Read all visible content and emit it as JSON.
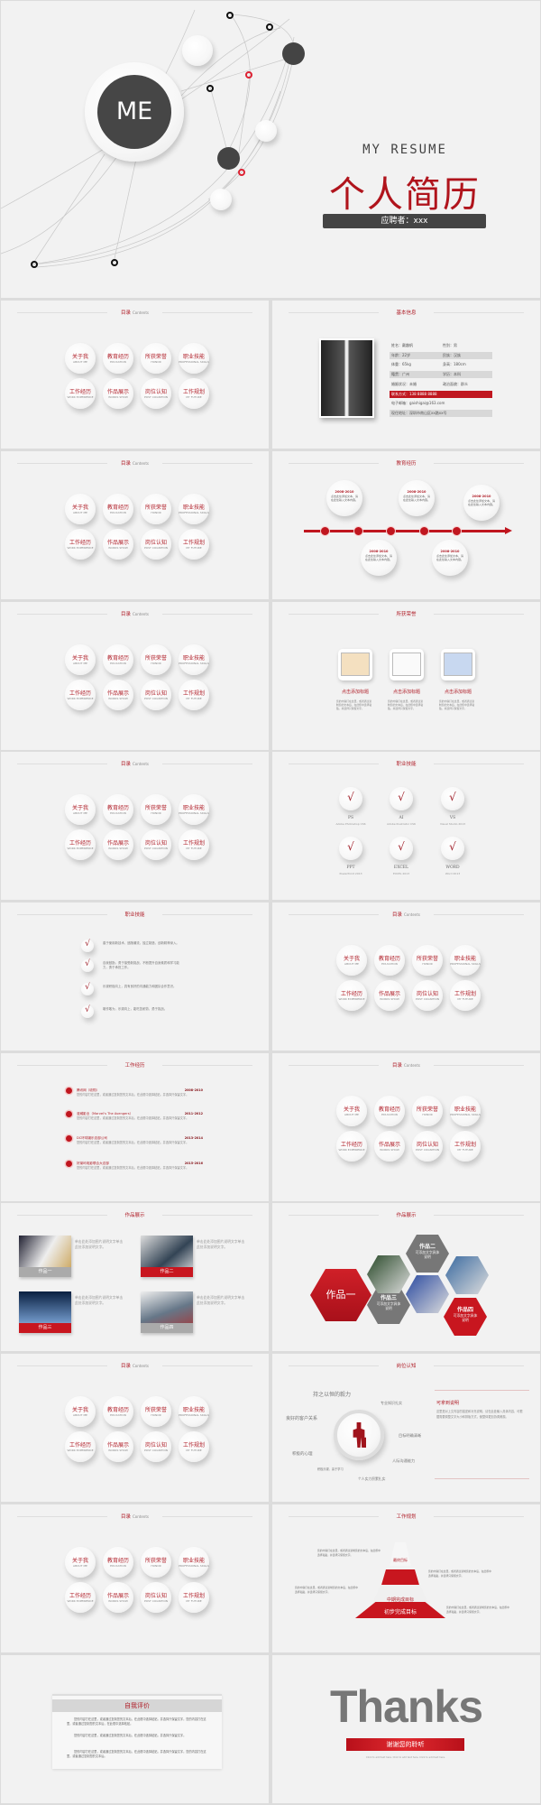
{
  "cover": {
    "me": "ME",
    "subtitle": "MY RESUME",
    "title": "个人简历",
    "applicant": "应聘者：xxx"
  },
  "contents": {
    "title": "目录",
    "title_en": "Contents",
    "items": [
      {
        "t": "关于我",
        "s": "ABOUT ME"
      },
      {
        "t": "教育经历",
        "s": "EDUCATION"
      },
      {
        "t": "所获荣誉",
        "s": "HONOR"
      },
      {
        "t": "职业技能",
        "s": "PROFESSIONAL SKILLS"
      },
      {
        "t": "工作经历",
        "s": "WORK EXPERIENCE"
      },
      {
        "t": "作品展示",
        "s": "WORKS SHOW"
      },
      {
        "t": "岗位认知",
        "s": "POST COGNITION"
      },
      {
        "t": "工作规划",
        "s": "MY FUTURE"
      }
    ]
  },
  "basic": {
    "title": "基本信息",
    "rows": [
      [
        "姓名：戴趣帆",
        "性别：男"
      ],
      [
        "年龄：22岁",
        "民族：汉族"
      ],
      [
        "体重：65kg",
        "身高：180cm"
      ],
      [
        "籍贯：广州",
        "学历：本科"
      ],
      [
        "婚姻状况：未婚",
        "政治面貌：群众"
      ],
      [
        "联系方式：138 8888 8888"
      ],
      [
        "电子邮箱：gaishigai@163.com"
      ],
      [
        "现住地址：深圳市南山区xx路xx号"
      ]
    ]
  },
  "education": {
    "title": "教育经历",
    "items": [
      {
        "date": "2008-2010",
        "text": "点击此处添加文本，请在此处输入文本内容。"
      },
      {
        "date": "2008-2010",
        "text": "点击此处添加文本，请在此处输入文本内容。"
      },
      {
        "date": "2008-2010",
        "text": "点击此处添加文本，请在此处输入文本内容。"
      },
      {
        "date": "2008-2010",
        "text": "点击此处添加文本，请在此处输入文本内容。"
      },
      {
        "date": "2008-2010",
        "text": "点击此处添加文本，请在此处输入文本内容。"
      }
    ]
  },
  "honor": {
    "title": "所获荣誉",
    "items": [
      {
        "t": "点击添加标题",
        "d": "您的内容打在这里，或者通过复制您的文本后，在此框中选择粘贴，并选择只保留文字。"
      },
      {
        "t": "点击添加标题",
        "d": "您的内容打在这里，或者通过复制您的文本后，在此框中选择粘贴，并选择只保留文字。"
      },
      {
        "t": "点击添加标题",
        "d": "您的内容打在这里，或者通过复制您的文本后，在此框中选择粘贴，并选择只保留文字。"
      }
    ]
  },
  "skills": {
    "title": "职业技能",
    "check": "√",
    "items": [
      {
        "t": "PS",
        "s": "Adobe Photoshop CS6"
      },
      {
        "t": "AI",
        "s": "Adobe Illustrator CS6"
      },
      {
        "t": "VS",
        "s": "Visual Studio 2013"
      },
      {
        "t": "PPT",
        "s": "PowerPoint 2013"
      },
      {
        "t": "EXCEL",
        "s": "EXCEL 2013"
      },
      {
        "t": "WORD",
        "s": "Word 2013"
      }
    ]
  },
  "skills2": {
    "title": "职业技能",
    "items": [
      "善于使用新技术，追随潮流，独立制造，创新精神深入。",
      "自我鼓励，勇于接受新挑战，不断提升自身素质和学习能力，勇于承担工作。",
      "乐观积极向上，具有良好的沟通能力和团队合作意识。",
      "敢作敢为，乐观向上，能吃苦耐劳，勇于挑战。"
    ]
  },
  "work": {
    "title": "工作经历",
    "items": [
      {
        "t": "腾讯网（收购）",
        "date": "2008-2010",
        "d": "您的内容打在这里，或者通过复制您的文本后，在此框中选择粘贴，并选择只保留文字。"
      },
      {
        "t": "漫威影业（Marvel's The Avengers）",
        "date": "2011-2012",
        "d": "您的内容打在这里，或者通过复制您的文本后，在此框中选择粘贴，并选择只保留文字。"
      },
      {
        "t": "DC环球娱乐总部公司",
        "date": "2013-2014",
        "d": "您的内容打在这里，或者通过复制您的文本后，在此框中选择粘贴，并选择只保留文字。"
      },
      {
        "t": "好莱坞电影联合大总部",
        "date": "2015-2016",
        "d": "您的内容打在这里，或者通过复制您的文本后，在此框中选择粘贴，并选择只保留文字。"
      }
    ]
  },
  "works": {
    "title": "作品展示",
    "items": [
      {
        "label": "作品一",
        "d": "单击此处添加图片说明文字单击此处添加说明文字。"
      },
      {
        "label": "作品二",
        "d": "单击此处添加图片说明文字单击此处添加说明文字。"
      },
      {
        "label": "作品三",
        "d": "单击此处添加图片说明文字单击此处添加说明文字。"
      },
      {
        "label": "作品四",
        "d": "单击此处添加图片说明文字单击此处添加说明文字。"
      }
    ]
  },
  "hex": {
    "title": "作品展示",
    "main": "作品一",
    "items": [
      {
        "t": "作品二",
        "s": "可添加文字具体说明"
      },
      {
        "t": "作品三",
        "s": "可添加文字具体说明"
      },
      {
        "t": "作品四",
        "s": "可添加文字具体说明"
      }
    ]
  },
  "post": {
    "title": "岗位认知",
    "labels": [
      "持之以恒的毅力",
      "良好的客户关系",
      "专业知识扎实",
      "目标明确清晰",
      "积极的心理",
      "积极乐观、善于学习",
      "人际沟通能力",
      "个人实力积累扎实"
    ],
    "panel_title": "可拿到说明",
    "panel_text": "这里是对上文内容的描述和补充说明，请在此处输入具体内容，可根据需要调整文字大小和排版方式，使整体更加协调美观。"
  },
  "plan": {
    "title": "工作规划",
    "levels": [
      "最终目标",
      "自我超越",
      "中期完成目标",
      "初步完成目标"
    ],
    "desc": "您的内容打在这里，或者通过复制您的文本后，在此框中选择粘贴，并选择只保留文字。"
  },
  "self": {
    "title": "自我评价",
    "paras": [
      "您的内容打在这里，或者通过复制您的文本后，在此框中选择粘贴，并选择只保留文字。您的内容打在这里，或者通过复制您的文本后，在此框中选择粘贴。",
      "您的内容打在这里，或者通过复制您的文本后，在此框中选择粘贴，并选择只保留文字。",
      "您的内容打在这里，或者通过复制您的文本后，在此框中选择粘贴，并选择只保留文字。您的内容打在这里，或者通过复制您的文本后。"
    ]
  },
  "thanks": {
    "title": "Thanks",
    "sub": "谢谢您的聆听",
    "small": "Click to add text here. Click to add text here. Click to add text here."
  },
  "colors": {
    "accent": "#c0161f",
    "dark": "#444444",
    "bg": "#f2f2f2"
  }
}
